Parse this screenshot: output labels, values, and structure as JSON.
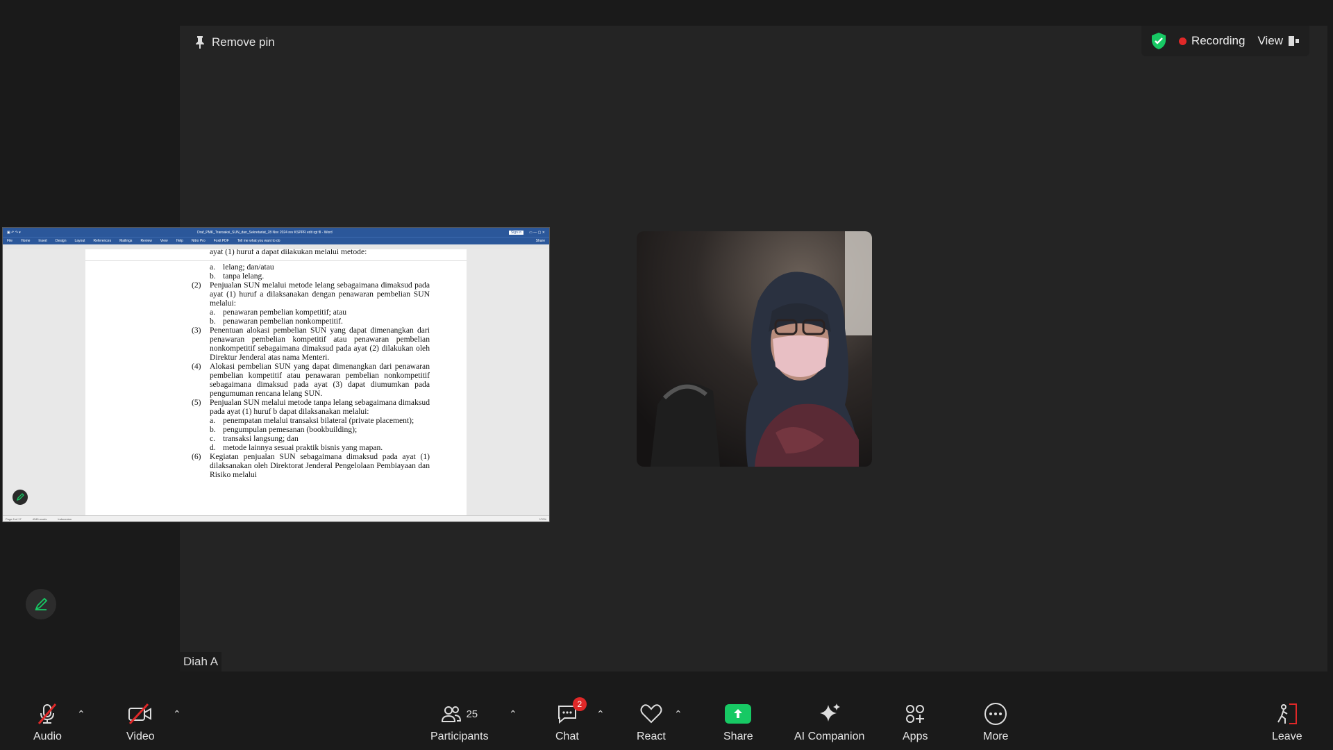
{
  "stage": {
    "remove_pin": "Remove pin",
    "participant_name": "Diah A"
  },
  "topbar": {
    "recording": "Recording",
    "view": "View"
  },
  "word": {
    "title": "Draf_PMK_Transaksi_SUN_dan_Sekretariat_28 Nov 2024 rev KSPPR edit rgt fll - Word",
    "sign_in": "Sign in",
    "ribbon": [
      "File",
      "Home",
      "Insert",
      "Design",
      "Layout",
      "References",
      "Mailings",
      "Review",
      "View",
      "Help",
      "Nitro Pro",
      "Foxit PDF",
      "Tell me what you want to do"
    ],
    "share_btn": "Share",
    "status_page": "Page 8 of 17",
    "status_words": "4345 words",
    "status_lang": "Indonesian",
    "zoom": "170%",
    "doc": {
      "top_line": "ayat (1) huruf a dapat dilakukan melalui metode:",
      "a1": "a.",
      "a1_text": "lelang; dan/atau",
      "b1": "b.",
      "b1_text": "tanpa lelang.",
      "p2": "(2)",
      "p2_text": "Penjualan SUN melalui metode lelang sebagaimana dimaksud pada ayat (1) huruf a dilaksanakan dengan penawaran pembelian SUN melalui:",
      "p2a": "a.",
      "p2a_text": "penawaran pembelian kompetitif; atau",
      "p2b": "b.",
      "p2b_text": "penawaran pembelian nonkompetitif.",
      "p3": "(3)",
      "p3_text": "Penentuan alokasi pembelian SUN yang dapat dimenangkan dari penawaran pembelian kompetitif atau penawaran pembelian nonkompetitif sebagaimana dimaksud pada ayat (2) dilakukan oleh Direktur Jenderal atas nama Menteri.",
      "p4": "(4)",
      "p4_text": "Alokasi pembelian SUN yang dapat dimenangkan dari penawaran pembelian kompetitif atau penawaran pembelian nonkompetitif sebagaimana dimaksud pada ayat (3) dapat diumumkan pada pengumuman rencana lelang SUN.",
      "p5": "(5)",
      "p5_text": "Penjualan SUN melalui metode tanpa lelang sebagaimana dimaksud pada ayat (1) huruf b dapat dilaksanakan melalui:",
      "p5a": "a.",
      "p5a_text": "penempatan melalui transaksi bilateral (private placement);",
      "p5b": "b.",
      "p5b_text": "pengumpulan pemesanan (bookbuilding);",
      "p5c": "c.",
      "p5c_text": "transaksi langsung; dan",
      "p5d": "d.",
      "p5d_text": "metode lainnya sesuai praktik bisnis yang mapan.",
      "p6": "(6)",
      "p6_text": "Kegiatan penjualan SUN sebagaimana dimaksud pada ayat (1) dilaksanakan oleh Direktorat Jenderal Pengelolaan Pembiayaan dan Risiko melalui"
    }
  },
  "toolbar": {
    "audio": "Audio",
    "video": "Video",
    "participants": "Participants",
    "participants_count": "25",
    "chat": "Chat",
    "chat_badge": "2",
    "react": "React",
    "share": "Share",
    "ai": "AI Companion",
    "apps": "Apps",
    "more": "More",
    "leave": "Leave"
  },
  "colors": {
    "share_green": "#17c964",
    "recording_red": "#e02828",
    "word_blue": "#2b579a"
  }
}
